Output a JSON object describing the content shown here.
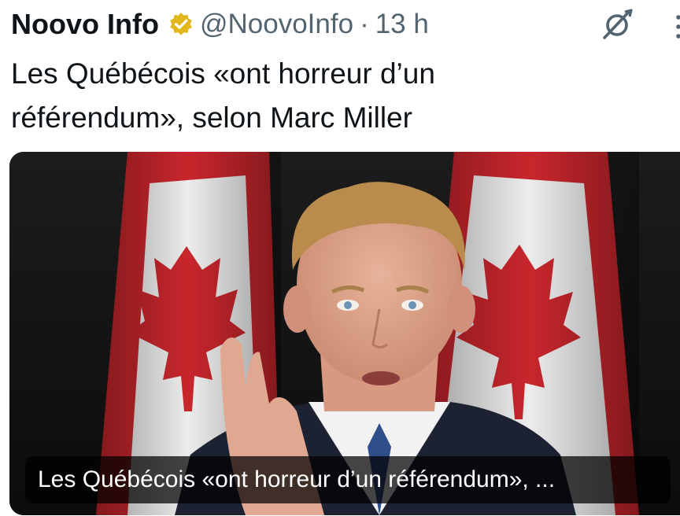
{
  "tweet": {
    "author_name": "Noovo Info",
    "handle": "@NoovoInfo",
    "separator": "·",
    "time": "13 h",
    "verified_color": "#e2b719",
    "text_line1": "Les Québécois «ont horreur d’un",
    "text_line2": "référendum», selon Marc Miller"
  },
  "media": {
    "caption": "Les Québécois «ont horreur d’un référendum», ..."
  },
  "icons": {
    "verified": "verified-badge-icon",
    "grok": "grok-icon",
    "more": "more-icon"
  }
}
